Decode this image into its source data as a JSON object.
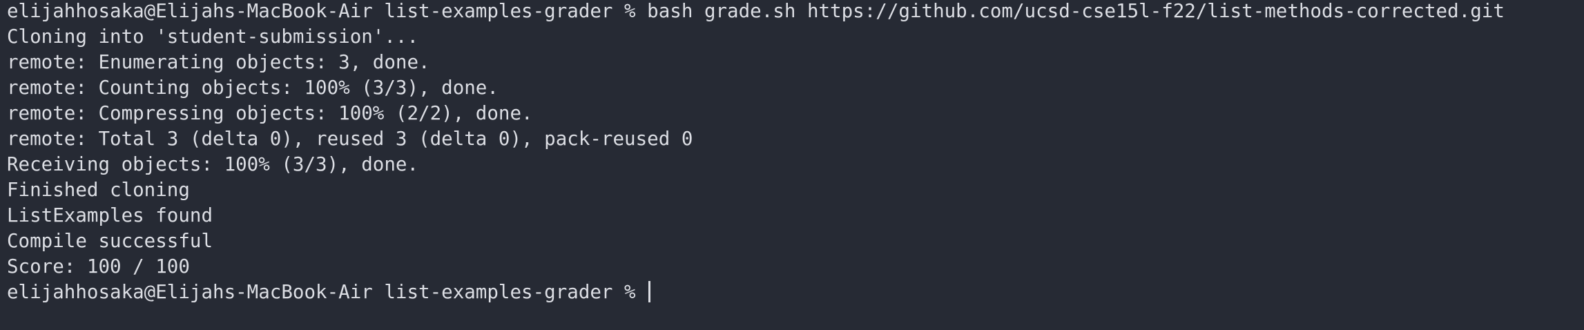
{
  "terminal": {
    "lines": [
      "elijahhosaka@Elijahs-MacBook-Air list-examples-grader % bash grade.sh https://github.com/ucsd-cse15l-f22/list-methods-corrected.git",
      "Cloning into 'student-submission'...",
      "remote: Enumerating objects: 3, done.",
      "remote: Counting objects: 100% (3/3), done.",
      "remote: Compressing objects: 100% (2/2), done.",
      "remote: Total 3 (delta 0), reused 3 (delta 0), pack-reused 0",
      "Receiving objects: 100% (3/3), done.",
      "Finished cloning",
      "ListExamples found",
      "Compile successful",
      "Score: 100 / 100"
    ],
    "prompt": "elijahhosaka@Elijahs-MacBook-Air list-examples-grader % "
  },
  "colors": {
    "background": "#262a34",
    "foreground": "#dcdee4"
  }
}
